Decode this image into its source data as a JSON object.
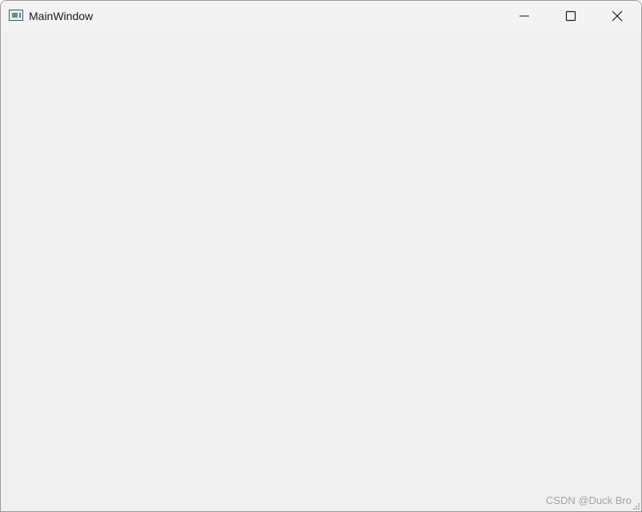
{
  "window": {
    "title": "MainWindow"
  },
  "icons": {
    "app": "app-window-icon",
    "minimize": "minimize-icon",
    "maximize": "maximize-icon",
    "close": "close-icon",
    "resize_grip": "resize-grip-icon"
  },
  "watermark": {
    "text": "CSDN @Duck Bro"
  },
  "colors": {
    "client_background": "#f0f0f0",
    "titlebar_background": "#f3f3f3",
    "title_text": "#1a1a1a",
    "watermark_text": "#a3a3a3"
  }
}
